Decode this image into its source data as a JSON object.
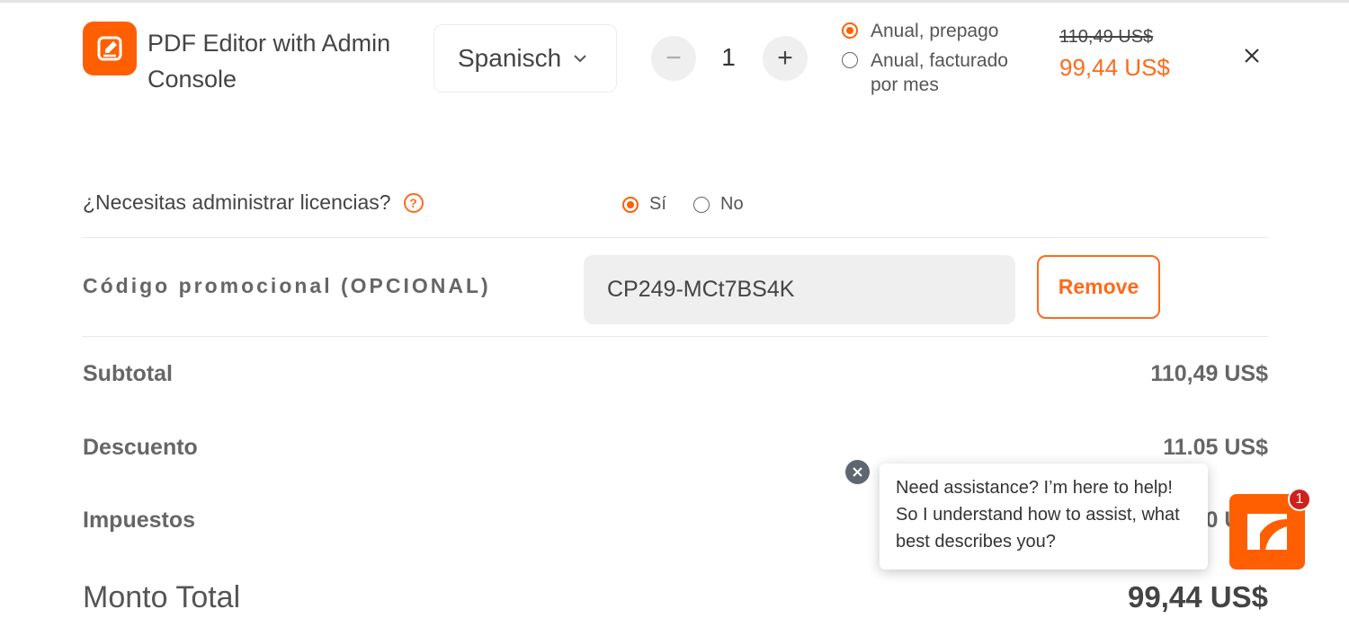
{
  "product": {
    "name": "PDF Editor with Admin Console",
    "icon": "pdf-editor-icon",
    "language": "Spanisch",
    "quantity": "1",
    "qty_minus": "−",
    "qty_plus": "+"
  },
  "billing": {
    "options": [
      {
        "label": "Anual, prepago",
        "selected": true
      },
      {
        "label": "Anual, facturado por mes",
        "selected": false
      }
    ],
    "old_price": "110,49 US$",
    "new_price": "99,44 US$"
  },
  "license": {
    "question": "¿Necesitas administrar licencias?",
    "help_symbol": "?",
    "options": [
      {
        "label": "Sí",
        "selected": true
      },
      {
        "label": "No",
        "selected": false
      }
    ]
  },
  "promo": {
    "label": "Código promocional (OPCIONAL)",
    "code": "CP249-MCt7BS4K",
    "remove_label": "Remove"
  },
  "summary": {
    "subtotal_label": "Subtotal",
    "subtotal_value": "110,49 US$",
    "discount_label": "Descuento",
    "discount_value": "11.05 US$",
    "taxes_label": "Impuestos",
    "taxes_value": "0 US$",
    "total_label": "Monto Total",
    "total_value": "99,44 US$"
  },
  "chat": {
    "message": "Need assistance? I’m here to help! So I understand how to assist, what best describes you?",
    "badge_count": "1"
  },
  "colors": {
    "accent": "#ff5f00",
    "badge": "#d0201b"
  }
}
